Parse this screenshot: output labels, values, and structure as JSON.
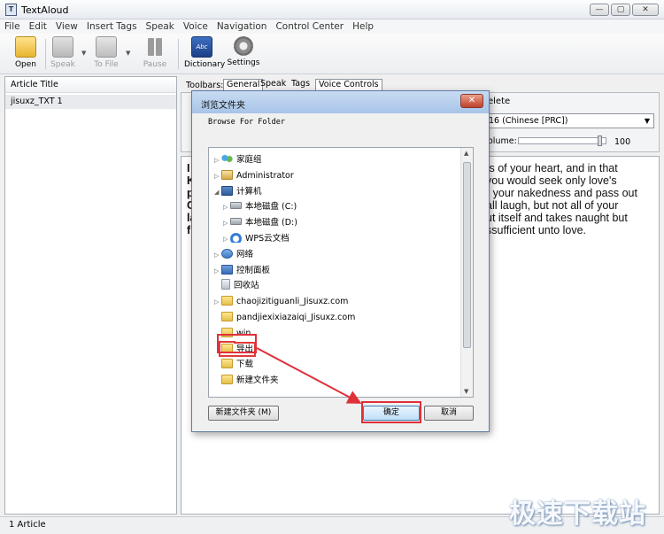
{
  "window": {
    "title": "TextAloud",
    "icon_letter": "T",
    "min": "—",
    "max": "▢",
    "close": "✕"
  },
  "menu": [
    "File",
    "Edit",
    "View",
    "Insert Tags",
    "Speak",
    "Voice",
    "Navigation",
    "Control Center",
    "Help"
  ],
  "toolbar": {
    "open": "Open",
    "speak": "Speak",
    "tofile": "To File",
    "pause": "Pause",
    "dictionary": "Dictionary",
    "dictionary_icon_text": "Abc",
    "settings": "Settings"
  },
  "article_list": {
    "header": "Article Title",
    "items": [
      "jisuxz_TXT 1"
    ]
  },
  "right": {
    "toolbars_label": "Toolbars:",
    "tabs": [
      "General",
      "Speak",
      "Tags",
      "Voice Controls"
    ],
    "delete": "elete",
    "voice": "16 (Chinese [PRC])",
    "volume_label": "olume:",
    "volume_value": "100",
    "volume_level": 0.95,
    "text_lead": [
      "I",
      "K",
      "p",
      "C",
      "la",
      "f"
    ],
    "text_lines": [
      "ts of your heart, and in that",
      "you would seek only love's",
      "r your nakedness and pass out",
      "all laugh, but not all of your",
      "ut itself and takes naught but",
      "ssufficient unto love."
    ]
  },
  "status": "1 Article",
  "watermark": "极速下载站",
  "dialog": {
    "title": "浏览文件夹",
    "description": "Browse For Folder",
    "close": "✕",
    "tree": [
      {
        "label": "家庭组",
        "icon": "homegroup",
        "indent": 0,
        "expander": "▷"
      },
      {
        "label": "Administrator",
        "icon": "user",
        "indent": 0,
        "expander": "▷"
      },
      {
        "label": "计算机",
        "icon": "computer",
        "indent": 0,
        "expander": "◢"
      },
      {
        "label": "本地磁盘 (C:)",
        "icon": "disk",
        "indent": 1,
        "expander": "▷"
      },
      {
        "label": "本地磁盘 (D:)",
        "icon": "disk",
        "indent": 1,
        "expander": "▷"
      },
      {
        "label": "WPS云文档",
        "icon": "cloud",
        "indent": 1,
        "expander": "▷"
      },
      {
        "label": "网络",
        "icon": "network",
        "indent": 0,
        "expander": "▷"
      },
      {
        "label": "控制面板",
        "icon": "cpanel",
        "indent": 0,
        "expander": "▷"
      },
      {
        "label": "回收站",
        "icon": "recycle",
        "indent": 0,
        "expander": ""
      },
      {
        "label": "chaojizitiguanli_Jisuxz.com",
        "icon": "folder",
        "indent": 0,
        "expander": "▷"
      },
      {
        "label": "pandjiexixiazaiqi_Jisuxz.com",
        "icon": "folder",
        "indent": 0,
        "expander": ""
      },
      {
        "label": "win",
        "icon": "folder",
        "indent": 0,
        "expander": ""
      },
      {
        "label": "导出",
        "icon": "folder",
        "indent": 0,
        "expander": "",
        "selected": true
      },
      {
        "label": "下载",
        "icon": "folder",
        "indent": 0,
        "expander": ""
      },
      {
        "label": "新建文件夹",
        "icon": "folder",
        "indent": 0,
        "expander": ""
      }
    ],
    "new_folder": "新建文件夹 (M)",
    "ok": "确定",
    "cancel": "取消"
  }
}
